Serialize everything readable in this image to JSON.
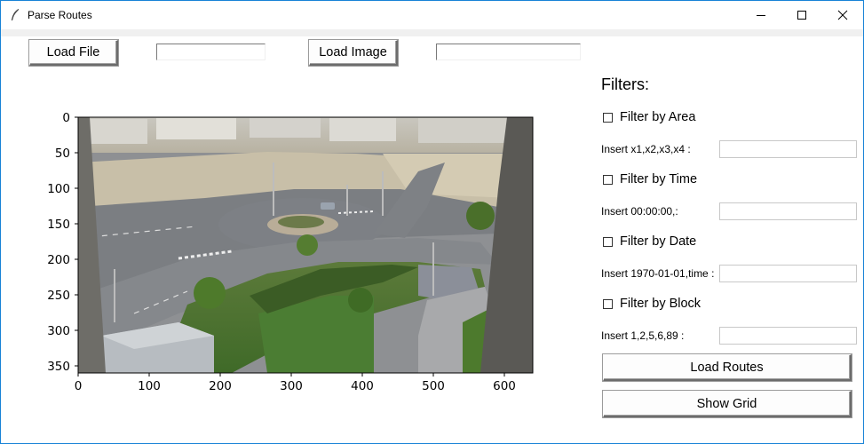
{
  "window": {
    "title": "Parse Routes",
    "controls": [
      "minimize-icon",
      "maximize-icon",
      "close-icon"
    ]
  },
  "toolbar": {
    "load_file_label": "Load File",
    "file_path_value": "",
    "load_image_label": "Load Image",
    "image_path_value": ""
  },
  "image_plot": {
    "x_ticks": [
      "0",
      "100",
      "200",
      "300",
      "400",
      "500",
      "600"
    ],
    "y_ticks": [
      "0",
      "50",
      "100",
      "150",
      "200",
      "250",
      "300",
      "350"
    ],
    "x_range": [
      0,
      640
    ],
    "y_range": [
      0,
      360
    ]
  },
  "filters": {
    "title": "Filters:",
    "area": {
      "checkbox_label": "Filter by Area",
      "checked": false,
      "insert_label": "Insert x1,x2,x3,x4 :",
      "value": ""
    },
    "time": {
      "checkbox_label": "Filter by Time",
      "checked": false,
      "insert_label": "Insert 00:00:00,:",
      "value": ""
    },
    "date": {
      "checkbox_label": "Filter by Date",
      "checked": false,
      "insert_label": "Insert 1970-01-01,time :",
      "value": ""
    },
    "block": {
      "checkbox_label": "Filter by Block",
      "checked": false,
      "insert_label": "Insert 1,2,5,6,89 :",
      "value": ""
    }
  },
  "actions": {
    "load_routes_label": "Load Routes",
    "show_grid_label": "Show Grid"
  }
}
